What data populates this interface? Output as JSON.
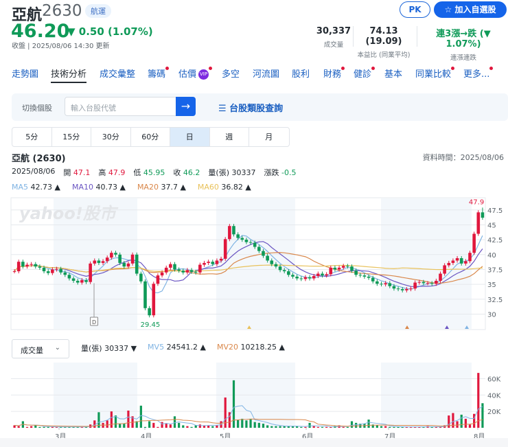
{
  "header": {
    "name": "亞航",
    "code": "2630",
    "industry_tag": "航運",
    "price": "46.20",
    "change": "▼ 0.50 (1.07%)",
    "update": "收盤 | 2025/08/06 14:30 更新",
    "pk_label": "PK",
    "add_watchlist_label": "加入自選股"
  },
  "stats": [
    {
      "value": "30,337",
      "label": "成交量"
    },
    {
      "value": "74.13 (19.09)",
      "label": "本益比 (同業平均)"
    },
    {
      "value": "連3漲→跌 (▼ 1.07%)",
      "label": "連漲連跌"
    }
  ],
  "nav": [
    {
      "label": "走勢圖",
      "dot": false
    },
    {
      "label": "技術分析",
      "dot": false
    },
    {
      "label": "成交彙整",
      "dot": false
    },
    {
      "label": "籌碼",
      "dot": true
    },
    {
      "label": "估價",
      "dot": true,
      "badge": "VIP"
    },
    {
      "label": "多空",
      "dot": false
    },
    {
      "label": "河流圖",
      "dot": false
    },
    {
      "label": "股利",
      "dot": false
    },
    {
      "label": "財務",
      "dot": true
    },
    {
      "label": "健診",
      "dot": true
    },
    {
      "label": "基本",
      "dot": false
    },
    {
      "label": "同業比較",
      "dot": true
    },
    {
      "label": "更多...",
      "dot": true
    }
  ],
  "switcher": {
    "label": "切換個股",
    "placeholder": "輸入台股代號",
    "go": "→",
    "category_query": "☰ 台股類股查詢"
  },
  "periods": [
    "5分",
    "15分",
    "30分",
    "60分",
    "日",
    "週",
    "月"
  ],
  "active_period": "日",
  "chart_header": {
    "title": "亞航 (2630)",
    "data_time": "資料時間：2025/08/06",
    "date": "2025/08/06",
    "open_label": "開",
    "open": "47.1",
    "high_label": "高",
    "high": "47.9",
    "low_label": "低",
    "low": "45.95",
    "close_label": "收",
    "close": "46.2",
    "vol_label": "量(張)",
    "vol": "30337",
    "chg_label": "漲跌",
    "chg": "-0.5"
  },
  "ma_legend": [
    {
      "label": "MA5",
      "value": "42.73 ▲",
      "color": "#7fb3e3"
    },
    {
      "label": "MA10",
      "value": "40.73 ▲",
      "color": "#6a55c2"
    },
    {
      "label": "MA20",
      "value": "37.7 ▲",
      "color": "#d9874a"
    },
    {
      "label": "MA60",
      "value": "36.82 ▲",
      "color": "#e8c15a"
    }
  ],
  "volume_panel": {
    "selector": "成交量",
    "chevron": "⌄",
    "vol_label": "量(張)",
    "vol": "30337 ▼",
    "mv5_label": "MV5",
    "mv5": "24541.2 ▲",
    "mv20_label": "MV20",
    "mv20": "10218.25 ▲"
  },
  "watermark": "yahoo!股市",
  "chart_data": {
    "type": "candlestick",
    "price_axis": {
      "ticks": [
        30,
        32.5,
        35,
        37.5,
        40,
        42.5,
        45,
        47.5
      ],
      "tick_labels": [
        "30",
        "32.5",
        "35",
        "37.5",
        "40",
        "42.5",
        "45",
        "47.5"
      ],
      "range": [
        27.4,
        49.9
      ]
    },
    "volume_axis": {
      "ticks": [
        20,
        40,
        60
      ],
      "tick_labels": [
        "20K",
        "40K",
        "60K"
      ],
      "range": [
        0,
        78
      ]
    },
    "months": [
      "3月",
      "4月",
      "5月",
      "6月",
      "7月",
      "8月"
    ],
    "closes": [
      37.2,
      38.8,
      38.0,
      38.3,
      38.4,
      38.0,
      37.8,
      37.2,
      36.9,
      37.5,
      37.6,
      37.0,
      36.6,
      36.0,
      35.6,
      35.3,
      35.7,
      35.4,
      38.5,
      39.0,
      38.6,
      38.9,
      39.5,
      40.3,
      40.0,
      38.6,
      38.0,
      38.5,
      40.0,
      36.8,
      35.5,
      31.0,
      29.8,
      35.1,
      36.5,
      37.0,
      37.8,
      38.4,
      37.5,
      37.3,
      37.0,
      37.4,
      37.1,
      37.0,
      38.3,
      38.6,
      38.8,
      38.4,
      39.0,
      39.3,
      42.6,
      44.8,
      43.4,
      42.8,
      42.5,
      42.1,
      42.0,
      41.3,
      40.6,
      39.8,
      39.0,
      38.4,
      38.0,
      37.4,
      37.2,
      36.6,
      36.3,
      36.0,
      35.9,
      36.2,
      36.0,
      36.4,
      36.8,
      36.5,
      36.7,
      37.8,
      37.5,
      37.8,
      38.1,
      38.0,
      37.3,
      36.6,
      36.5,
      36.3,
      36.1,
      35.5,
      35.1,
      35.0,
      35.2,
      34.7,
      34.3,
      34.2,
      34.0,
      34.2,
      34.3,
      35.3,
      35.4,
      35.2,
      35.2,
      35.1,
      35.6,
      36.8,
      38.2,
      38.6,
      39.0,
      39.4,
      38.5,
      38.9,
      40.3,
      43.5,
      47.1,
      46.2
    ],
    "volumes_k": [
      3,
      2,
      8,
      1,
      2,
      3,
      1,
      1,
      1,
      1,
      1,
      1,
      1,
      1,
      1,
      1,
      1,
      1,
      4,
      9,
      19,
      6,
      9,
      20,
      15,
      5,
      5,
      21,
      14,
      8,
      27,
      1,
      8,
      6,
      1,
      7,
      5,
      4,
      14,
      6,
      3,
      2,
      1,
      3,
      4,
      3,
      3,
      2,
      3,
      8,
      37,
      19,
      58,
      10,
      11,
      9,
      11,
      7,
      6,
      5,
      3,
      2,
      2,
      2,
      2,
      2,
      2,
      2,
      1,
      1,
      6,
      2,
      1,
      1,
      1,
      1,
      2,
      3,
      1,
      1,
      8,
      6,
      5,
      5,
      10,
      4,
      3,
      2,
      2,
      1,
      1,
      1,
      1,
      1,
      1,
      1,
      1,
      1,
      2,
      1,
      1,
      1,
      3,
      15,
      18,
      8,
      16,
      11,
      4,
      17,
      67,
      30
    ],
    "high_label": "47.9",
    "low_label": "29.45",
    "marker_label": "D",
    "ma_periods": [
      5,
      10,
      20,
      60
    ],
    "mv_periods": [
      5,
      20
    ]
  },
  "colors": {
    "up": "#e0173d",
    "down": "#0f9a58",
    "band": "#f3f7fb",
    "grid": "#e6e9ed"
  }
}
